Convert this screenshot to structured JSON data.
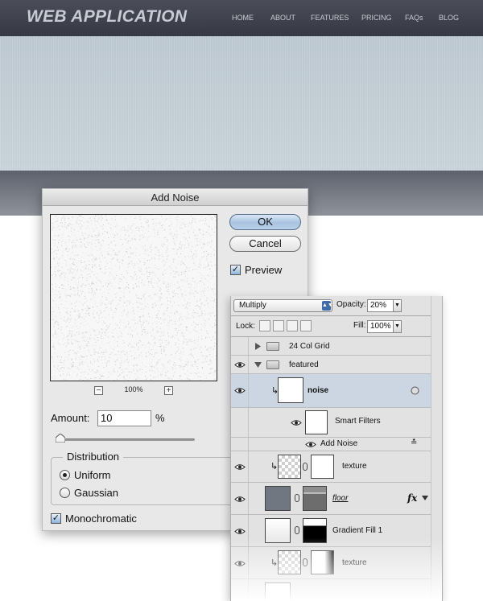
{
  "site": {
    "logo": "WEB APPLICATION",
    "nav": [
      "HOME",
      "ABOUT",
      "FEATURES",
      "PRICING",
      "FAQs",
      "BLOG"
    ]
  },
  "dialog": {
    "title": "Add Noise",
    "ok": "OK",
    "cancel": "Cancel",
    "preview_label": "Preview",
    "zoom_minus": "−",
    "zoom_plus": "+",
    "zoom_level": "100%",
    "amount_label": "Amount:",
    "amount_value": "10",
    "amount_unit": "%",
    "amount_slider_fraction": 0.025,
    "distribution_label": "Distribution",
    "uniform": "Uniform",
    "gaussian": "Gaussian",
    "selected_distribution": "Uniform",
    "monochromatic": "Monochromatic",
    "preview_checked": true,
    "monochromatic_checked": true
  },
  "layers": {
    "blend_mode": "Multiply",
    "opacity_label": "Opacity:",
    "opacity_value": "20%",
    "lock_label": "Lock:",
    "fill_label": "Fill:",
    "fill_value": "100%",
    "rows": {
      "grid": "24 Col Grid",
      "featured": "featured",
      "noise": "noise",
      "smart_filters": "Smart Filters",
      "add_noise": "Add Noise",
      "texture": "texture",
      "floor": "floor",
      "gradient": "Gradient Fill 1",
      "texture2": "texture"
    },
    "fx": "fx"
  },
  "colors": {
    "header_bg": "#3b3e48",
    "hero_bg": "#c4cfd6",
    "selected_layer": "#cbd6e2",
    "ok_button": "#a9c3e0"
  }
}
